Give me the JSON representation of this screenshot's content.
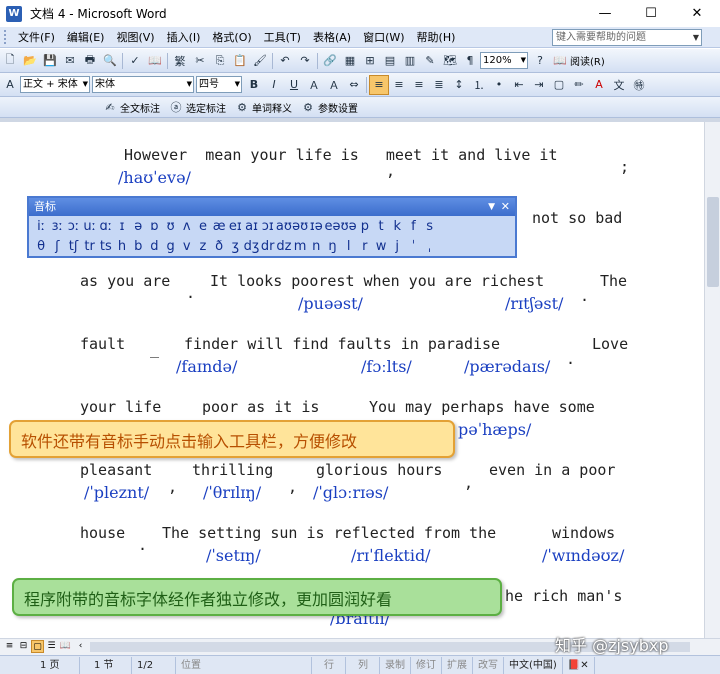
{
  "window": {
    "title": "文档 4 - Microsoft Word",
    "minimize": "—",
    "maximize": "☐",
    "close": "✕"
  },
  "menu": [
    "文件(F)",
    "编辑(E)",
    "视图(V)",
    "插入(I)",
    "格式(O)",
    "工具(T)",
    "表格(A)",
    "窗口(W)",
    "帮助(H)"
  ],
  "help": {
    "placeholder": "键入需要帮助的问题"
  },
  "std_toolbar": {
    "convert": "繁",
    "zoom": "120%",
    "read": "阅读(R)"
  },
  "fmt_toolbar": {
    "style": "正文 + 宋体",
    "font": "宋体",
    "size": "四号",
    "bold": "B",
    "italic": "I",
    "underline": "U"
  },
  "addin_toolbar": {
    "btn1": "全文标注",
    "btn2": "选定标注",
    "btn3": "单词释义",
    "btn4": "参数设置"
  },
  "ipa_panel": {
    "title": "音标",
    "row1": [
      "iː",
      "ɜː",
      "ɔː",
      "uː",
      "ɑː",
      "ɪ",
      "ə",
      "ɒ",
      "ʊ",
      "ʌ",
      "e",
      "æ",
      "eɪ",
      "aɪ",
      "ɔɪ",
      "aʊ",
      "əʊ",
      "ɪə",
      "eə",
      "ʊə",
      "p",
      "t",
      "k",
      "f",
      "s"
    ],
    "row2": [
      "θ",
      "ʃ",
      "tʃ",
      "tr",
      "ts",
      "h",
      "b",
      "d",
      "g",
      "v",
      "z",
      "ð",
      "ʒ",
      "dʒ",
      "dr",
      "dz",
      "m",
      "n",
      "ŋ",
      "l",
      "r",
      "w",
      "j",
      "ˈ",
      "ˌ"
    ]
  },
  "document": {
    "line1": {
      "words": "However  mean your life is   meet it and live it",
      "mark1": ",",
      "mark2": ";",
      "ipa1": "/haʊˈevə/"
    },
    "line2": {
      "words": "not so bad"
    },
    "line3": {
      "w1": "as you are",
      "dot1": ".",
      "w2": "It looks poorest when you are richest",
      "w3": "The",
      "ipa1": "/puəəst/",
      "ipa2": "/rɪtʃəst/",
      "dot2": "."
    },
    "line4": {
      "w1": "fault",
      "dash": "_",
      "w2": "finder will find faults in paradise",
      "w3": "Love",
      "ipa1": "/faɪndə/",
      "ipa2": "/fɔːlts/",
      "ipa3": "/pærədaɪs/",
      "dot": "."
    },
    "line5": {
      "w1": "your life",
      "w2": "poor as it is",
      "w3": "You may perhaps have some",
      "ipa1": "pəˈhæps/"
    },
    "line6": {
      "w1": "pleasant",
      "w2": "thrilling",
      "w3": "glorious hours",
      "w4": "even in a poor",
      "ipa1": "/ˈpleznt/",
      "ipa2": "/ˈθrɪlɪŋ/",
      "ipa3": "/ˈglɔːrɪəs/",
      "c1": ",",
      "c2": ",",
      "c3": ","
    },
    "line7": {
      "w1": "house",
      "dot": ".",
      "w2": "The setting sun is reflected from the",
      "w3": "windows",
      "ipa1": "/ˈsetɪŋ/",
      "ipa2": "/rɪˈflektid/",
      "ipa3": "/ˈwɪndəʊz/"
    },
    "line8": {
      "w1": "he rich man's",
      "ipa1": "/braɪtli/"
    }
  },
  "callouts": {
    "orange": "软件还带有音标手动点击输入工具栏，方便修改",
    "green": "程序附带的音标字体经作者独立修改，更加圆润好看"
  },
  "status": {
    "page": "1 页",
    "section": "1 节",
    "pages": "1/2",
    "pos": "位置",
    "line": "行",
    "col": "列",
    "rec": "录制",
    "trk": "修订",
    "ext": "扩展",
    "ovr": "改写",
    "lang": "中文(中国)"
  },
  "watermark": "知乎 @zjsybxp"
}
